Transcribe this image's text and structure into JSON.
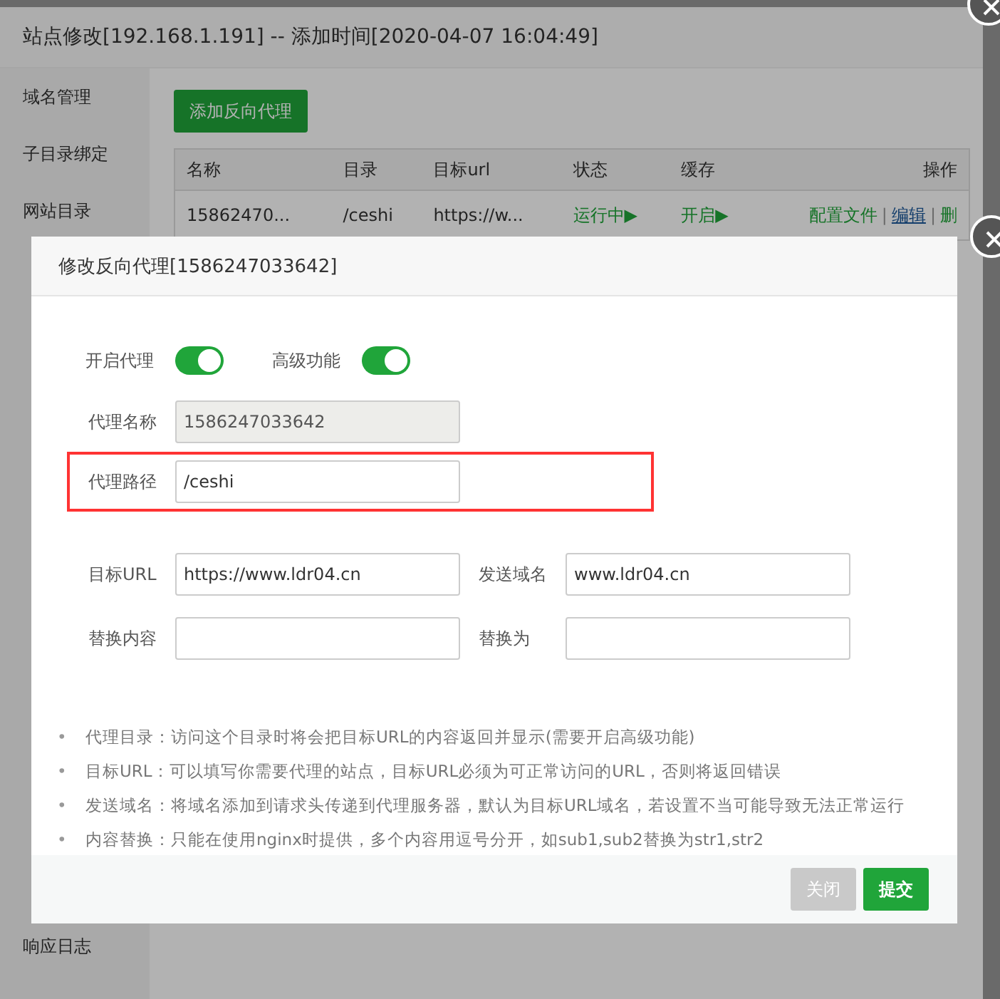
{
  "outer_dialog": {
    "title": "站点修改[192.168.1.191] -- 添加时间[2020-04-07 16:04:49]",
    "sidebar": [
      {
        "label": "域名管理",
        "selected": false
      },
      {
        "label": "子目录绑定",
        "selected": false
      },
      {
        "label": "网站目录",
        "selected": false
      },
      {
        "label": "响应日志",
        "selected": false
      }
    ],
    "add_button": "添加反向代理",
    "table": {
      "columns": [
        "名称",
        "目录",
        "目标url",
        "状态",
        "缓存",
        "操作"
      ],
      "rows": [
        {
          "name": "15862470...",
          "directory": "/ceshi",
          "target_url": "https://w...",
          "status": "运行中▶",
          "cache": "开启▶",
          "actions": [
            {
              "label": "配置文件",
              "kind": "plain"
            },
            {
              "label": "编辑",
              "kind": "underline"
            },
            {
              "label": "删",
              "kind": "plain"
            }
          ],
          "separator": "|"
        }
      ]
    }
  },
  "modal": {
    "title": "修改反向代理[1586247033642]",
    "toggles": [
      {
        "label": "开启代理",
        "on": true
      },
      {
        "label": "高级功能",
        "on": true
      }
    ],
    "rows": [
      {
        "highlighted": false,
        "fields": [
          {
            "label": "代理名称",
            "value": "1586247033642",
            "disabled": true
          }
        ]
      },
      {
        "highlighted": true,
        "fields": [
          {
            "label": "代理路径",
            "value": "/ceshi",
            "disabled": false
          }
        ]
      },
      {
        "highlighted": false,
        "fields": [
          {
            "label": "目标URL",
            "value": "https://www.ldr04.cn",
            "disabled": false
          },
          {
            "label": "发送域名",
            "value": "www.ldr04.cn",
            "disabled": false
          }
        ]
      },
      {
        "highlighted": false,
        "fields": [
          {
            "label": "替换内容",
            "disabled": false
          },
          {
            "label": "替换为",
            "disabled": false
          }
        ]
      }
    ],
    "bullet": "•",
    "notes": [
      "代理目录：访问这个目录时将会把目标URL的内容返回并显示(需要开启高级功能)",
      "目标URL：可以填写你需要代理的站点，目标URL必须为可正常访问的URL，否则将返回错误",
      "发送域名：将域名添加到请求头传递到代理服务器，默认为目标URL域名，若设置不当可能导致无法正常运行",
      "内容替换：只能在使用nginx时提供，多个内容用逗号分开，如sub1,sub2替换为str1,str2"
    ],
    "buttons": [
      {
        "label": "关闭",
        "kind": "secondary"
      },
      {
        "label": "提交",
        "kind": "primary"
      }
    ]
  }
}
